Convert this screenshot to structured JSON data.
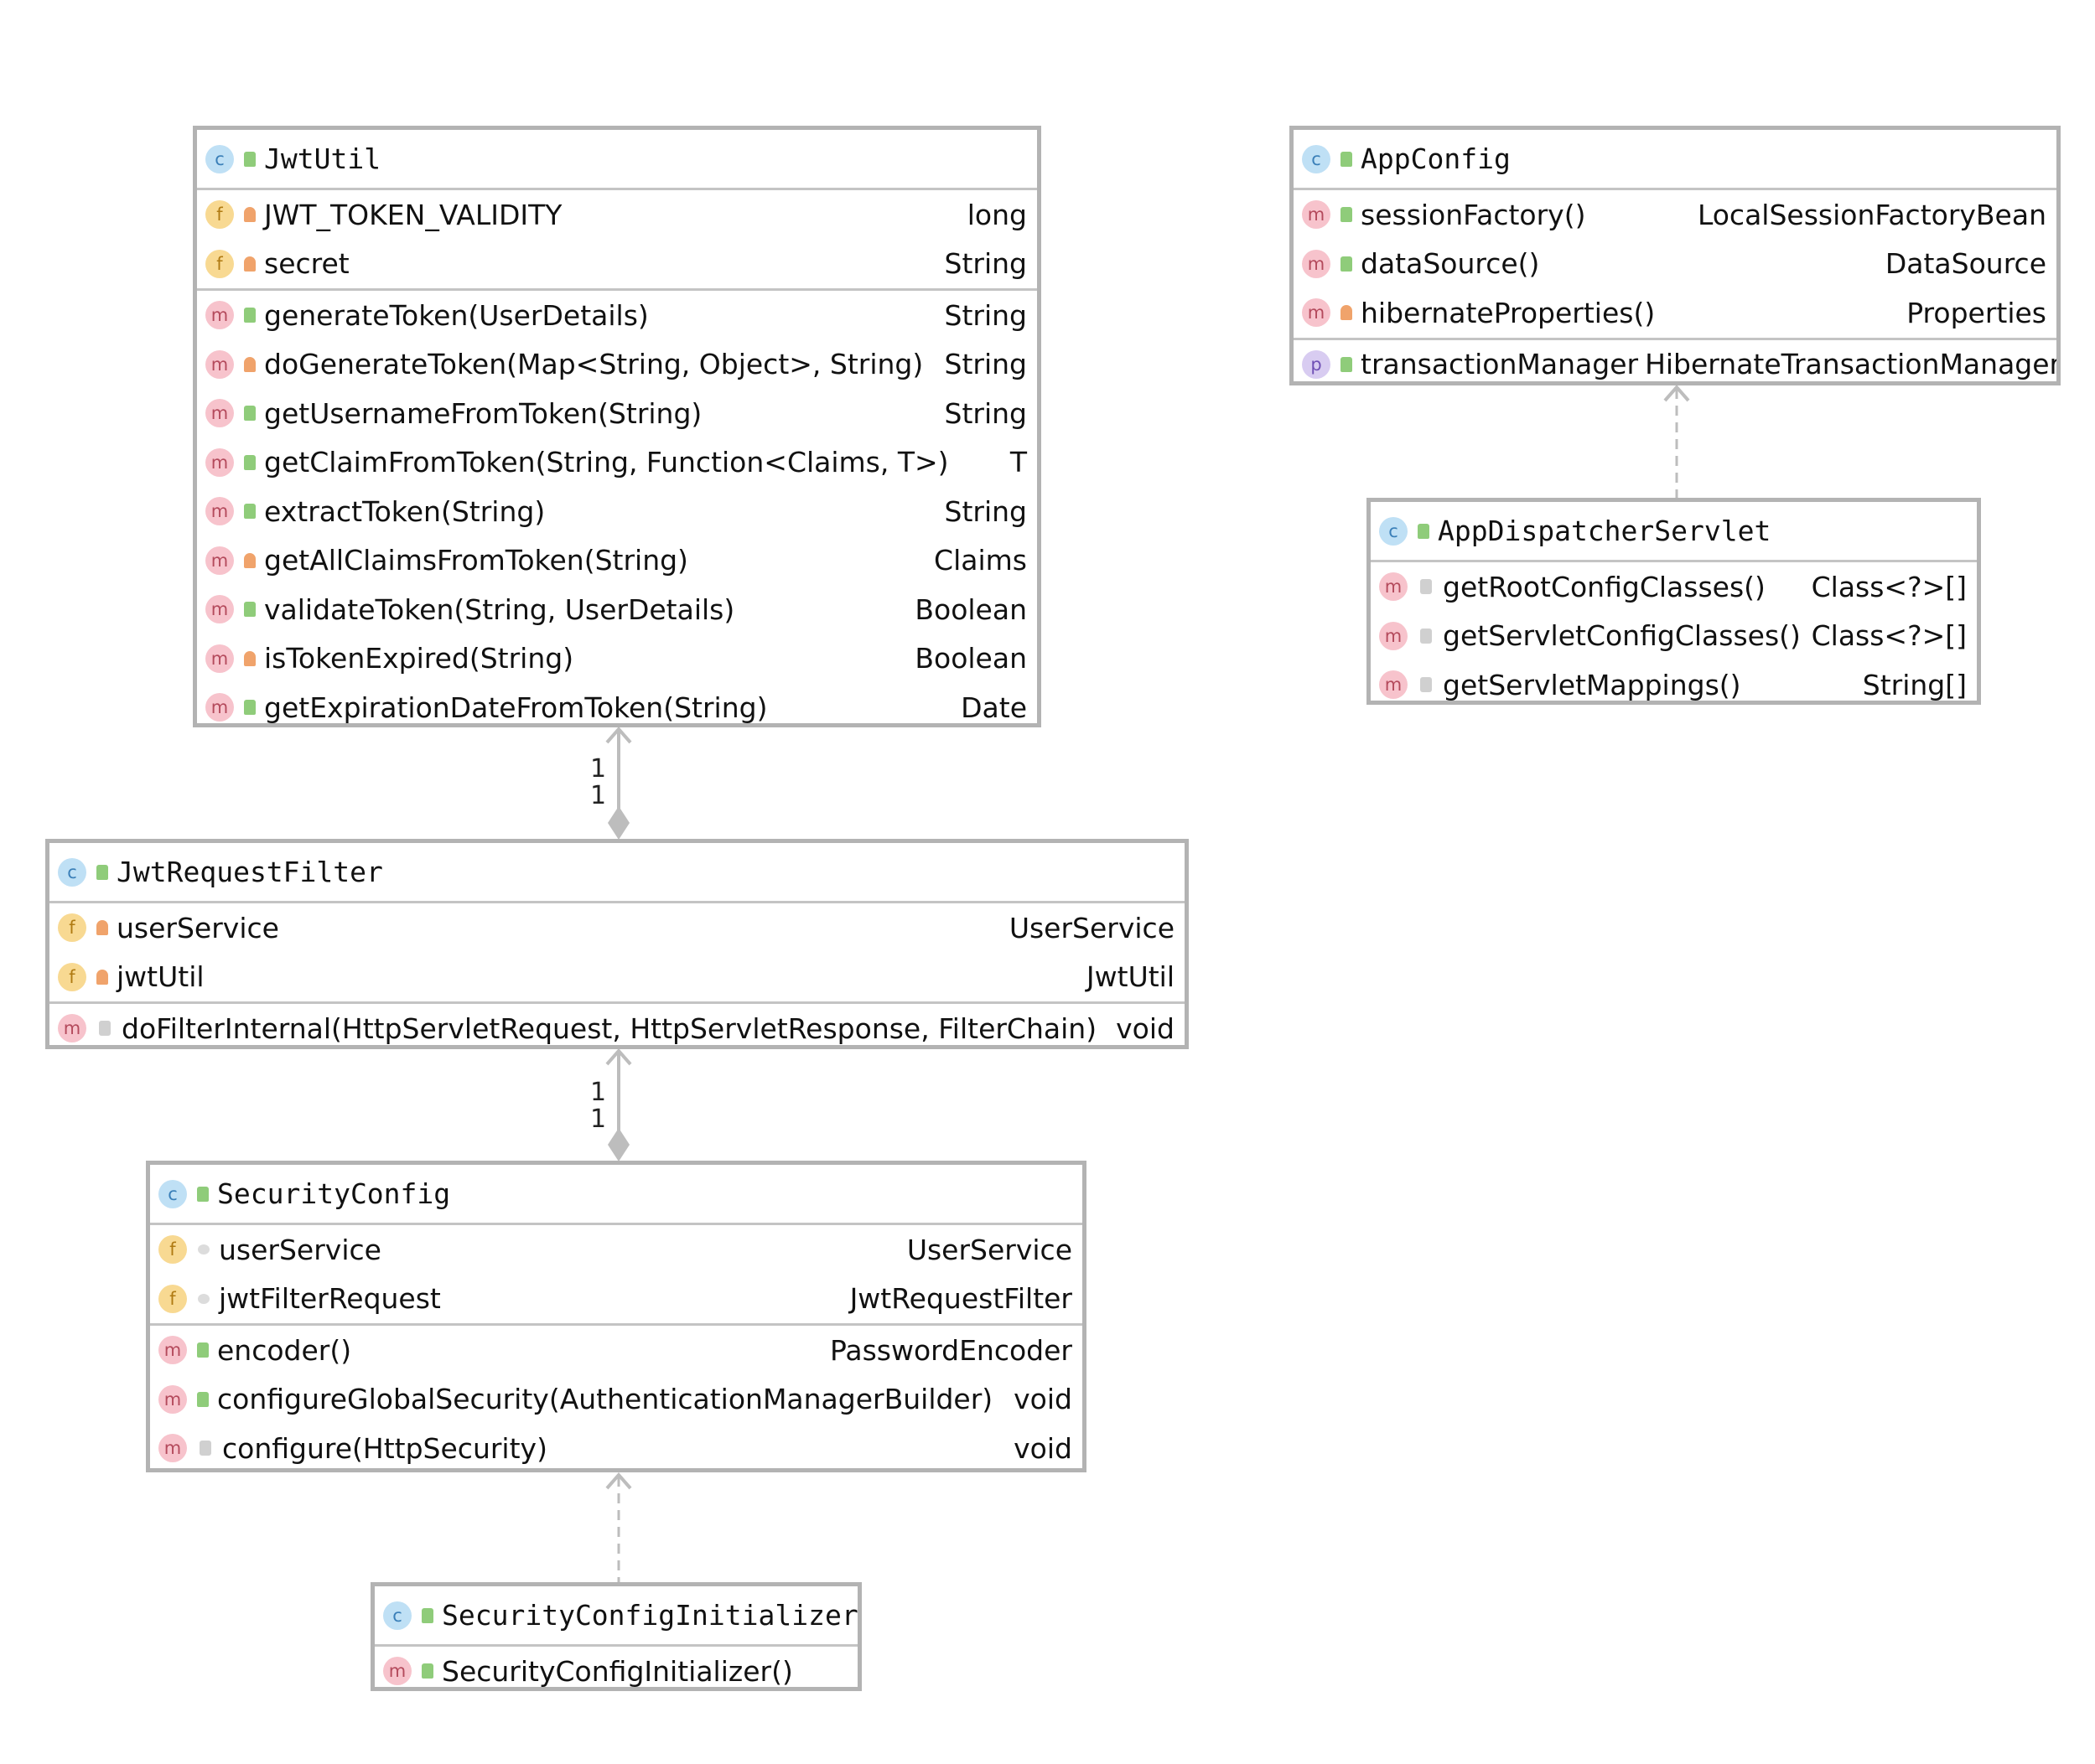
{
  "colors": {
    "border": "#b3b3b3",
    "connector": "#bdbdbd",
    "class_icon": "#bfe0f5",
    "field_icon": "#f8d992",
    "method_icon": "#f7c3cc",
    "property_icon": "#d8ccf1",
    "public": "#8fcc7a",
    "private": "#f0a36b"
  },
  "classes": {
    "jwtutil": {
      "name": "JwtUtil",
      "fields": [
        {
          "name": "JWT_TOKEN_VALIDITY",
          "type": "long",
          "icon": "field-icon",
          "visibility": "private"
        },
        {
          "name": "secret",
          "type": "String",
          "icon": "field-icon",
          "visibility": "private"
        }
      ],
      "methods": [
        {
          "name": "generateToken(UserDetails)",
          "type": "String",
          "icon": "method-icon",
          "visibility": "public"
        },
        {
          "name": "doGenerateToken(Map<String, Object>, String)",
          "type": "String",
          "icon": "method-icon",
          "visibility": "private"
        },
        {
          "name": "getUsernameFromToken(String)",
          "type": "String",
          "icon": "method-icon",
          "visibility": "public"
        },
        {
          "name": "getClaimFromToken(String, Function<Claims, T>)",
          "type": "T",
          "icon": "method-icon",
          "visibility": "public"
        },
        {
          "name": "extractToken(String)",
          "type": "String",
          "icon": "method-icon",
          "visibility": "public"
        },
        {
          "name": "getAllClaimsFromToken(String)",
          "type": "Claims",
          "icon": "method-icon",
          "visibility": "private"
        },
        {
          "name": "validateToken(String, UserDetails)",
          "type": "Boolean",
          "icon": "method-icon",
          "visibility": "public"
        },
        {
          "name": "isTokenExpired(String)",
          "type": "Boolean",
          "icon": "method-icon",
          "visibility": "private"
        },
        {
          "name": "getExpirationDateFromToken(String)",
          "type": "Date",
          "icon": "method-icon",
          "visibility": "public"
        }
      ]
    },
    "appconfig": {
      "name": "AppConfig",
      "methods": [
        {
          "name": "sessionFactory()",
          "type": "LocalSessionFactoryBean",
          "icon": "method-icon",
          "visibility": "public"
        },
        {
          "name": "dataSource()",
          "type": "DataSource",
          "icon": "method-icon",
          "visibility": "public"
        },
        {
          "name": "hibernateProperties()",
          "type": "Properties",
          "icon": "method-icon",
          "visibility": "private"
        }
      ],
      "properties": [
        {
          "name": "transactionManager",
          "type": "HibernateTransactionManager",
          "icon": "property-icon",
          "visibility": "public"
        }
      ]
    },
    "appdispatcherservlet": {
      "name": "AppDispatcherServlet",
      "methods": [
        {
          "name": "getRootConfigClasses()",
          "type": "Class<?>[]",
          "icon": "method-icon",
          "visibility": "protected"
        },
        {
          "name": "getServletConfigClasses()",
          "type": "Class<?>[]",
          "icon": "method-icon",
          "visibility": "protected"
        },
        {
          "name": "getServletMappings()",
          "type": "String[]",
          "icon": "method-icon",
          "visibility": "protected"
        }
      ]
    },
    "jwtrequestfilter": {
      "name": "JwtRequestFilter",
      "fields": [
        {
          "name": "userService",
          "type": "UserService",
          "icon": "field-icon",
          "visibility": "private"
        },
        {
          "name": "jwtUtil",
          "type": "JwtUtil",
          "icon": "field-icon",
          "visibility": "private"
        }
      ],
      "methods": [
        {
          "name": "doFilterInternal(HttpServletRequest, HttpServletResponse, FilterChain)",
          "type": "void",
          "icon": "method-icon",
          "visibility": "protected"
        }
      ]
    },
    "securityconfig": {
      "name": "SecurityConfig",
      "fields": [
        {
          "name": "userService",
          "type": "UserService",
          "icon": "field-icon",
          "visibility": "package"
        },
        {
          "name": "jwtFilterRequest",
          "type": "JwtRequestFilter",
          "icon": "field-icon",
          "visibility": "package"
        }
      ],
      "methods": [
        {
          "name": "encoder()",
          "type": "PasswordEncoder",
          "icon": "method-icon",
          "visibility": "public"
        },
        {
          "name": "configureGlobalSecurity(AuthenticationManagerBuilder)",
          "type": "void",
          "icon": "method-icon",
          "visibility": "public"
        },
        {
          "name": "configure(HttpSecurity)",
          "type": "void",
          "icon": "method-icon",
          "visibility": "protected"
        }
      ]
    },
    "securityconfiginitializer": {
      "name": "SecurityConfigInitializer",
      "methods": [
        {
          "name": "SecurityConfigInitializer()",
          "type": "",
          "icon": "method-icon",
          "visibility": "public"
        }
      ]
    }
  },
  "relations": {
    "jwtutil_jwtrequestfilter": {
      "source_mult": "1",
      "target_mult": "1"
    },
    "jwtrequestfilter_securityconfig": {
      "source_mult": "1",
      "target_mult": "1"
    }
  }
}
